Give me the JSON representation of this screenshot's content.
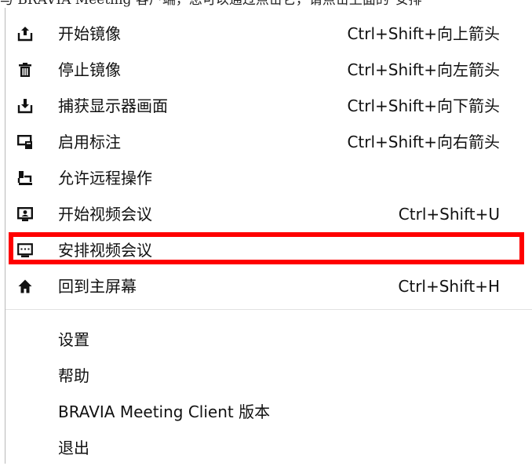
{
  "caption": "与 BRAVIA Meeting 客户端，您可以通过点击它，请点击上面的\"安排",
  "menu": {
    "items": [
      {
        "label": "开始镜像",
        "shortcut": "Ctrl+Shift+向上箭头",
        "icon": "upload-tray-icon"
      },
      {
        "label": "停止镜像",
        "shortcut": "Ctrl+Shift+向左箭头",
        "icon": "trash-icon"
      },
      {
        "label": "捕获显示器画面",
        "shortcut": "Ctrl+Shift+向下箭头",
        "icon": "download-tray-icon"
      },
      {
        "label": "启用标注",
        "shortcut": "Ctrl+Shift+向右箭头",
        "icon": "annotate-screen-icon"
      },
      {
        "label": "允许远程操作",
        "shortcut": "",
        "icon": "remote-control-icon"
      },
      {
        "label": "开始视频会议",
        "shortcut": "Ctrl+Shift+U",
        "icon": "video-conference-icon"
      },
      {
        "label": "安排视频会议",
        "shortcut": "",
        "icon": "schedule-meeting-icon"
      },
      {
        "label": "回到主屏幕",
        "shortcut": "Ctrl+Shift+H",
        "icon": "home-icon"
      },
      {
        "label": "设置",
        "shortcut": ""
      },
      {
        "label": "帮助",
        "shortcut": ""
      },
      {
        "label": "BRAVIA Meeting Client 版本",
        "shortcut": ""
      },
      {
        "label": "退出",
        "shortcut": ""
      }
    ]
  },
  "highlight_color": "#ff0000"
}
